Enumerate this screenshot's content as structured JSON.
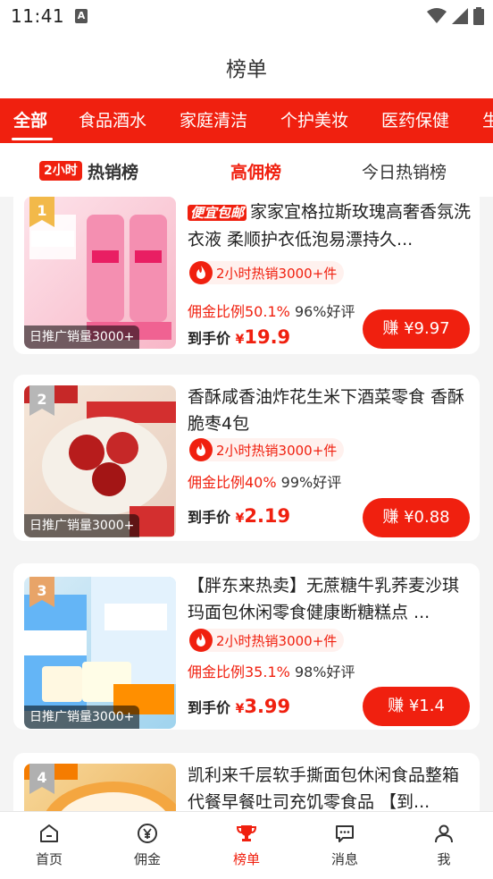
{
  "status_bar": {
    "time": "11:41",
    "badge": "A"
  },
  "header": {
    "title": "榜单"
  },
  "categories": [
    "全部",
    "食品酒水",
    "家庭清洁",
    "个护美妆",
    "医药保健",
    "生"
  ],
  "subtabs": {
    "badge": "2小时",
    "hot": "热销榜",
    "commission": "高佣榜",
    "today": "今日热销榜"
  },
  "products": [
    {
      "rank": "1",
      "promo": "便宜包邮",
      "title": "家家宜格拉斯玫瑰高奢香氛洗衣液 柔顺护衣低泡易漂持久...",
      "hot": "2小时热销3000+件",
      "ratio": "佣金比例50.1%",
      "rating": "96%好评",
      "price_label": "到手价",
      "currency": "¥",
      "price": "19.9",
      "earn": "赚 ¥9.97",
      "thumb_label": "日推广销量3000+"
    },
    {
      "rank": "2",
      "promo": "",
      "title": "香酥咸香油炸花生米下酒菜零食 香酥脆枣4包",
      "hot": "2小时热销3000+件",
      "ratio": "佣金比例40%",
      "rating": "99%好评",
      "price_label": "到手价",
      "currency": "¥",
      "price": "2.19",
      "earn": "赚 ¥0.88",
      "thumb_label": "日推广销量3000+"
    },
    {
      "rank": "3",
      "promo": "",
      "title": "【胖东来热卖】无蔗糖牛乳荞麦沙琪玛面包休闲零食健康断糖糕点 ...",
      "hot": "2小时热销3000+件",
      "ratio": "佣金比例35.1%",
      "rating": "98%好评",
      "price_label": "到手价",
      "currency": "¥",
      "price": "3.99",
      "earn": "赚 ¥1.4",
      "thumb_label": "日推广销量3000+"
    },
    {
      "rank": "4",
      "promo": "",
      "title": "凯利来千层软手撕面包休闲食品整箱代餐早餐吐司充饥零食品 【到...",
      "hot": "",
      "ratio": "",
      "rating": "",
      "price_label": "",
      "currency": "",
      "price": "",
      "earn": "",
      "thumb_label": ""
    }
  ],
  "bottom_nav": [
    {
      "label": "首页",
      "icon": "home-icon"
    },
    {
      "label": "佣金",
      "icon": "yen-icon"
    },
    {
      "label": "榜单",
      "icon": "trophy-icon"
    },
    {
      "label": "消息",
      "icon": "message-icon"
    },
    {
      "label": "我",
      "icon": "user-icon"
    }
  ],
  "colors": {
    "accent": "#f0200f",
    "background": "#f4f4f4"
  }
}
